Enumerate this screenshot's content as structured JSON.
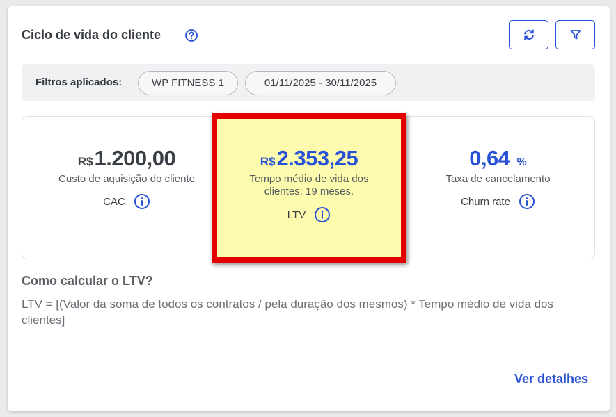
{
  "header": {
    "title": "Ciclo de vida do cliente",
    "help_icon": "question-circle-icon",
    "refresh_icon": "refresh-icon",
    "filter_icon": "funnel-icon"
  },
  "filters": {
    "label": "Filtros aplicados:",
    "chips": [
      "WP FITNESS 1",
      "01/11/2025 - 30/11/2025"
    ]
  },
  "metrics": {
    "cac": {
      "currency": "R$",
      "value": "1.200,00",
      "description": "Custo de aquisição do cliente",
      "tag": "CAC"
    },
    "ltv": {
      "currency": "R$",
      "value": "2.353,25",
      "description": "Tempo médio de vida dos clientes: 19 meses.",
      "tag": "LTV"
    },
    "churn": {
      "value": "0,64",
      "unit": "%",
      "description": "Taxa de cancelamento",
      "tag": "Churn rate"
    }
  },
  "calc": {
    "title": "Como calcular o LTV?",
    "formula": "LTV = [(Valor da soma de todos os contratos / pela duração dos mesmos) * Tempo médio de vida dos clientes]"
  },
  "footer": {
    "details_link": "Ver detalhes"
  },
  "colors": {
    "accent": "#2a52d6",
    "highlight_fill": "#fdfcae",
    "highlight_border": "#e50000"
  }
}
